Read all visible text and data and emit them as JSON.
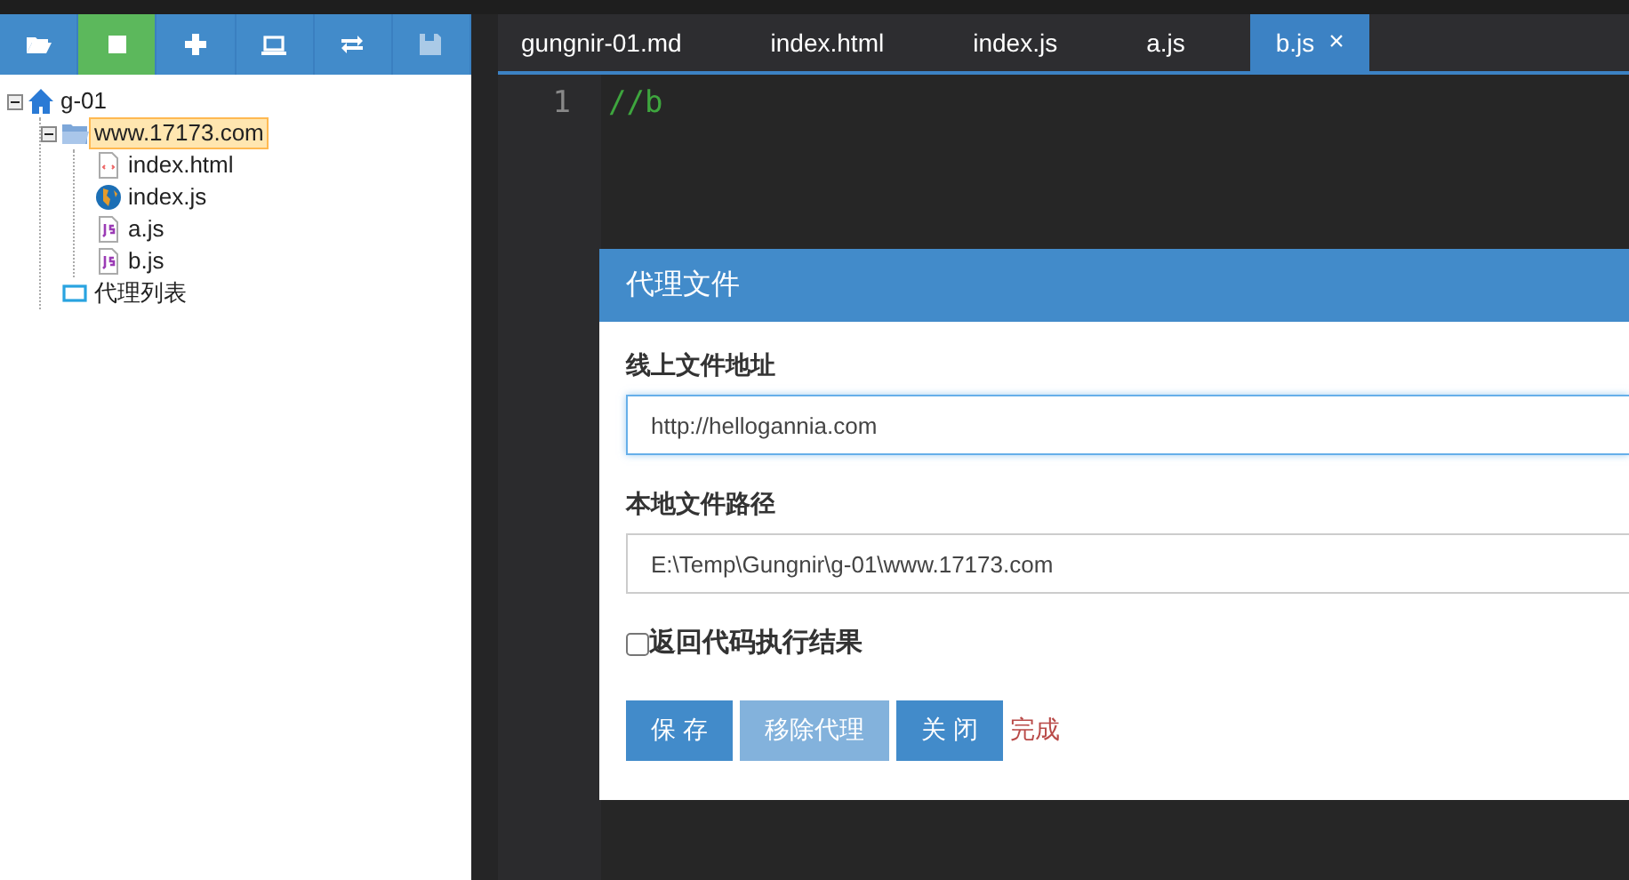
{
  "toolbar": [
    {
      "kind": "folder",
      "active": false,
      "disabled": false
    },
    {
      "kind": "stop",
      "active": true,
      "disabled": false
    },
    {
      "kind": "plus",
      "active": false,
      "disabled": false
    },
    {
      "kind": "laptop",
      "active": false,
      "disabled": false
    },
    {
      "kind": "refresh",
      "active": false,
      "disabled": false
    },
    {
      "kind": "save",
      "active": false,
      "disabled": true
    }
  ],
  "tree": [
    {
      "label": "g-01",
      "kind": "home",
      "expanded": true,
      "selected": false,
      "children": [
        {
          "label": "www.17173.com",
          "kind": "folder",
          "expanded": true,
          "selected": true,
          "children": [
            {
              "label": "index.html",
              "kind": "html",
              "selected": false
            },
            {
              "label": "index.js",
              "kind": "globe",
              "selected": false
            },
            {
              "label": "a.js",
              "kind": "js",
              "selected": false
            },
            {
              "label": "b.js",
              "kind": "js",
              "selected": false
            }
          ]
        },
        {
          "label": "代理列表",
          "kind": "proxy",
          "selected": false
        }
      ]
    }
  ],
  "tabs": [
    {
      "label": "gungnir-01.md",
      "selected": false
    },
    {
      "label": "index.html",
      "selected": false
    },
    {
      "label": "index.js",
      "selected": false
    },
    {
      "label": "a.js",
      "selected": false
    },
    {
      "label": "b.js",
      "selected": true,
      "close": "×"
    }
  ],
  "editor": {
    "lines": [
      {
        "number": "1",
        "code": "//b"
      }
    ]
  },
  "dialog": {
    "title": "代理文件",
    "fields": [
      {
        "label": "线上文件地址",
        "value": "http://hellogannia.com",
        "focused": true
      },
      {
        "label": "本地文件路径",
        "value": "E:\\Temp\\Gungnir\\g-01\\www.17173.com",
        "focused": false
      }
    ],
    "checkbox": {
      "label": "返回代码执行结果",
      "checked": false
    },
    "buttons": [
      {
        "label": "保 存",
        "disabled": false
      },
      {
        "label": "移除代理",
        "disabled": true
      },
      {
        "label": "关 闭",
        "disabled": false
      }
    ],
    "status": "完成"
  }
}
